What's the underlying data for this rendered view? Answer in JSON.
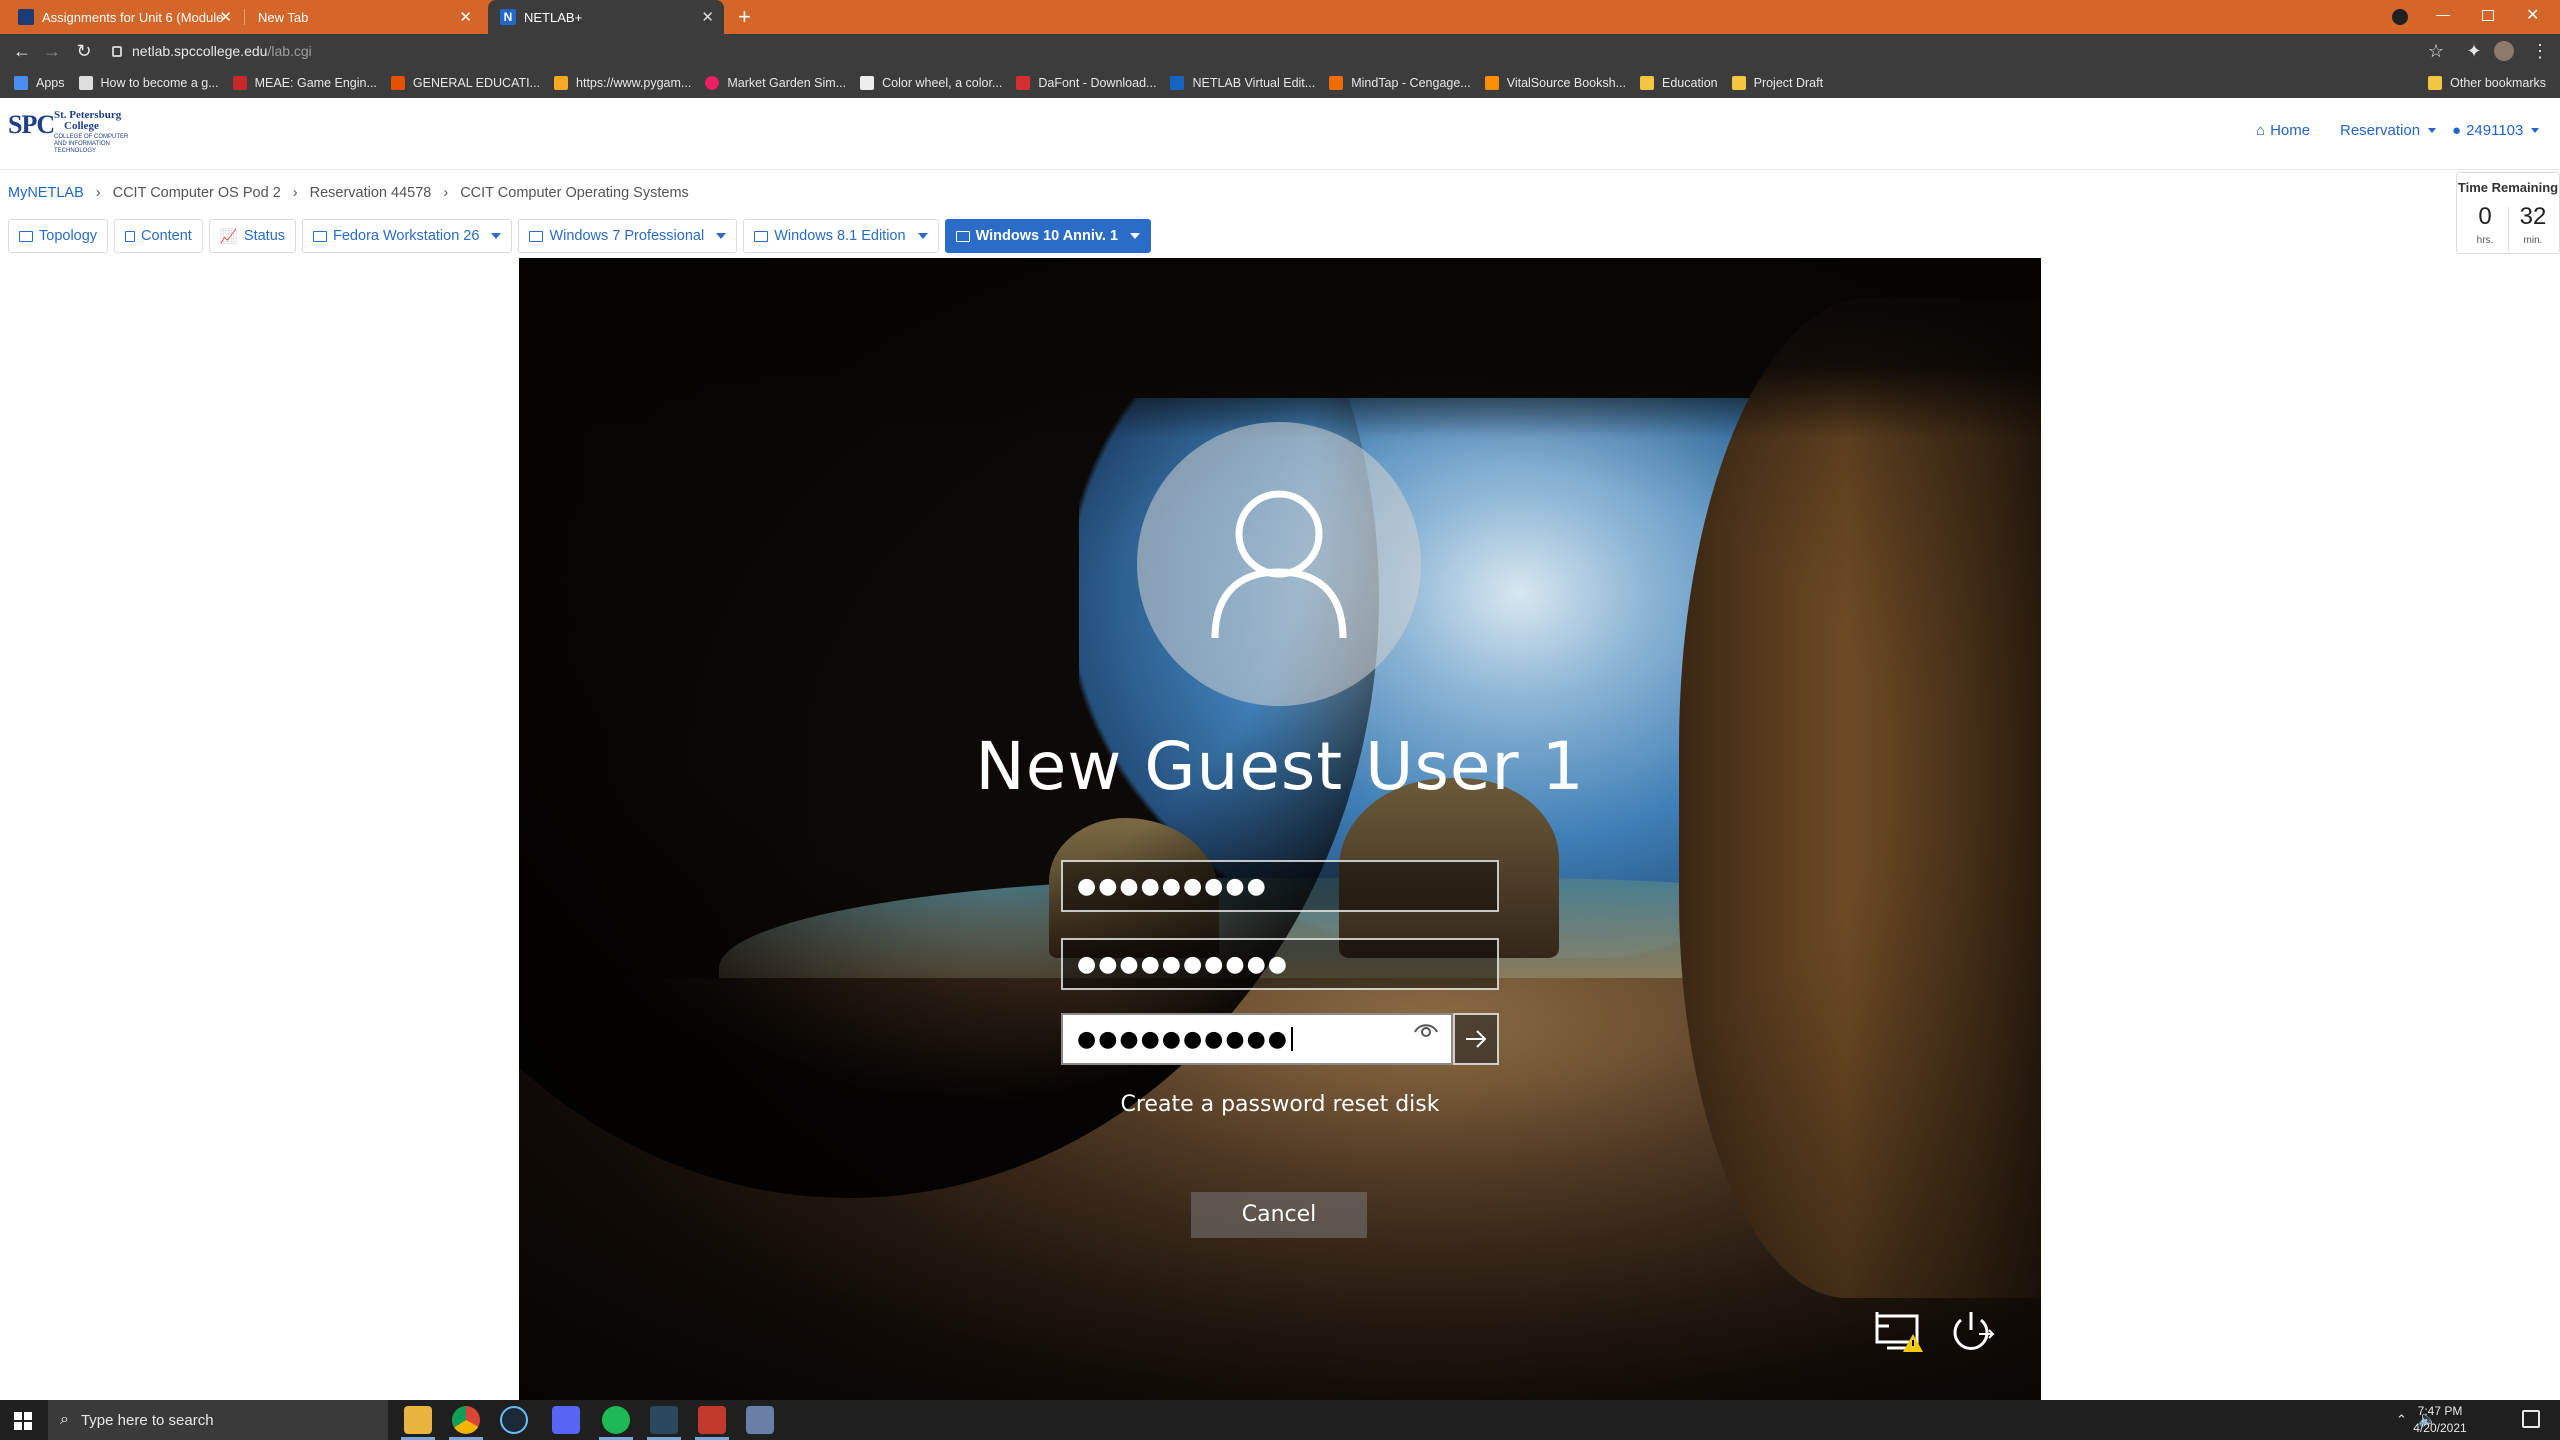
{
  "browser": {
    "tabs": [
      {
        "title": "Assignments for Unit 6 (Module",
        "favicon_color": "#1a3b73"
      },
      {
        "title": "New Tab",
        "favicon_color": ""
      },
      {
        "title": "NETLAB+",
        "favicon_color": "#2266cc"
      }
    ],
    "new_tab_symbol": "+",
    "url_host": "netlab.spccollege.edu",
    "url_path": "/lab.cgi",
    "bookmarks": [
      {
        "label": "Apps",
        "color": "#4a8df0"
      },
      {
        "label": "How to become a g...",
        "color": "#dddddd"
      },
      {
        "label": "MEAE: Game Engin...",
        "color": "#c62828"
      },
      {
        "label": "GENERAL EDUCATI...",
        "color": "#e65100"
      },
      {
        "label": "https://www.pygam...",
        "color": "#f9a825"
      },
      {
        "label": "Market Garden Sim...",
        "color": "#e91e63"
      },
      {
        "label": "Color wheel, a color...",
        "color": "#eeeeee"
      },
      {
        "label": "DaFont - Download...",
        "color": "#d32f2f"
      },
      {
        "label": "NETLAB Virtual Edit...",
        "color": "#1565c0"
      },
      {
        "label": "MindTap - Cengage...",
        "color": "#ef6c00"
      },
      {
        "label": "VitalSource Booksh...",
        "color": "#ff8f00"
      },
      {
        "label": "Education",
        "color": "#f4c542"
      },
      {
        "label": "Project Draft",
        "color": "#f4c542"
      }
    ],
    "other_bookmarks": "Other bookmarks"
  },
  "netlab": {
    "logo": {
      "initials": "SPC",
      "college_line1": "St. Petersburg",
      "college_line2": "College",
      "dept": "COLLEGE OF COMPUTER AND INFORMATION TECHNOLOGY"
    },
    "nav": {
      "home": "Home",
      "reservation": "Reservation",
      "user": "2491103"
    },
    "breadcrumbs": [
      "MyNETLAB",
      "CCIT Computer OS Pod 2",
      "Reservation 44578",
      "CCIT Computer Operating Systems"
    ],
    "tabs": [
      {
        "label": "Topology",
        "dropdown": false,
        "active": false
      },
      {
        "label": "Content",
        "dropdown": false,
        "active": false
      },
      {
        "label": "Status",
        "dropdown": false,
        "active": false
      },
      {
        "label": "Fedora Workstation 26",
        "dropdown": true,
        "active": false
      },
      {
        "label": "Windows 7 Professional",
        "dropdown": true,
        "active": false
      },
      {
        "label": "Windows 8.1 Edition",
        "dropdown": true,
        "active": false
      },
      {
        "label": "Windows 10 Anniv. 1",
        "dropdown": true,
        "active": true
      }
    ],
    "time_remaining": {
      "title": "Time Remaining",
      "hours": "0",
      "hours_unit": "hrs.",
      "minutes": "32",
      "minutes_unit": "min."
    }
  },
  "vm": {
    "username": "New Guest User 1",
    "fields": [
      {
        "value": "●●●●●●●●●",
        "focused": false
      },
      {
        "value": "●●●●●●●●●●",
        "focused": false
      },
      {
        "value": "●●●●●●●●●●",
        "focused": true
      }
    ],
    "reset_link": "Create a password reset disk",
    "cancel": "Cancel"
  },
  "taskbar": {
    "search_placeholder": "Type here to search",
    "time": "7:47 PM",
    "date": "4/20/2021"
  }
}
